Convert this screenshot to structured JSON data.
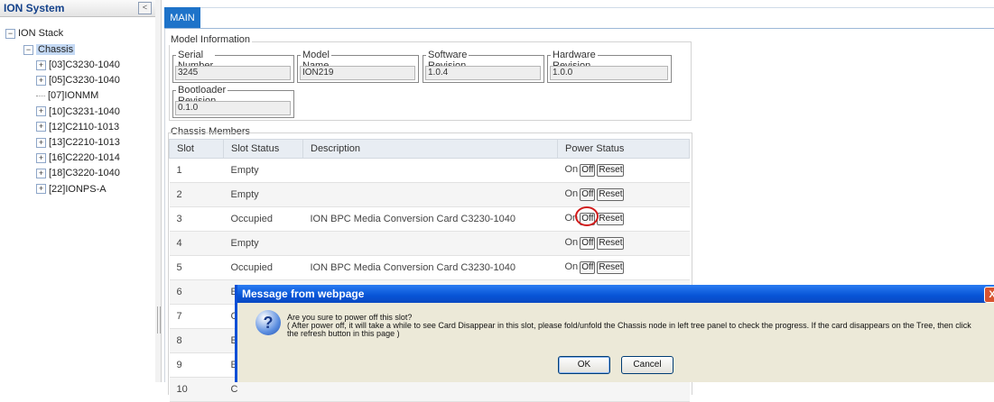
{
  "left_panel": {
    "title": "ION System",
    "collapse_glyph": "<",
    "tree": {
      "root": "ION Stack",
      "chassis": "Chassis",
      "items": [
        {
          "label": "[03]C3230-1040",
          "expandable": true
        },
        {
          "label": "[05]C3230-1040",
          "expandable": true
        },
        {
          "label": "[07]IONMM",
          "expandable": false
        },
        {
          "label": "[10]C3231-1040",
          "expandable": true
        },
        {
          "label": "[12]C2110-1013",
          "expandable": true
        },
        {
          "label": "[13]C2210-1013",
          "expandable": true
        },
        {
          "label": "[16]C2220-1014",
          "expandable": true
        },
        {
          "label": "[18]C3220-1040",
          "expandable": true
        },
        {
          "label": "[22]IONPS-A",
          "expandable": true
        }
      ]
    }
  },
  "main": {
    "tab_label": "MAIN",
    "model_info": {
      "legend": "Model Information",
      "serial_number": {
        "label": "Serial Number",
        "value": "3245"
      },
      "model_name": {
        "label": "Model Name",
        "value": "ION219"
      },
      "software_revision": {
        "label": "Software Revision",
        "value": "1.0.4"
      },
      "hardware_revision": {
        "label": "Hardware Revision",
        "value": "1.0.0"
      },
      "bootloader_revision": {
        "label": "Bootloader Revision",
        "value": "0.1.0"
      }
    },
    "chassis_members": {
      "legend": "Chassis Members",
      "headers": [
        "Slot",
        "Slot Status",
        "Description",
        "Power Status"
      ],
      "rows": [
        {
          "slot": "1",
          "status": "Empty",
          "description": ""
        },
        {
          "slot": "2",
          "status": "Empty",
          "description": ""
        },
        {
          "slot": "3",
          "status": "Occupied",
          "description": "ION BPC Media Conversion Card C3230-1040"
        },
        {
          "slot": "4",
          "status": "Empty",
          "description": ""
        },
        {
          "slot": "5",
          "status": "Occupied",
          "description": "ION BPC Media Conversion Card C3230-1040"
        },
        {
          "slot": "6",
          "status": "E",
          "description": ""
        },
        {
          "slot": "7",
          "status": "C",
          "description": ""
        },
        {
          "slot": "8",
          "status": "E",
          "description": ""
        },
        {
          "slot": "9",
          "status": "E",
          "description": ""
        },
        {
          "slot": "10",
          "status": "C",
          "description": ""
        }
      ],
      "power_buttons": {
        "on": "On",
        "off": "Off",
        "reset": "Reset"
      }
    }
  },
  "dialog": {
    "title": "Message from webpage",
    "close_glyph": "X",
    "icon_glyph": "?",
    "line1": "Are you sure to power off this slot?",
    "line2": "( After power off, it will take a while to see Card Disappear in this slot, please fold/unfold the Chassis node in left tree panel to check the progress. If the card disappears on the Tree, then click",
    "line3": "the refresh button in this page )",
    "ok_label": "OK",
    "cancel_label": "Cancel"
  },
  "colors": {
    "tab_active": "#1e73c9",
    "dialog_title": "#0754d6",
    "highlight_circle": "#d11b1b",
    "tree_selected": "#c4d9f4"
  }
}
